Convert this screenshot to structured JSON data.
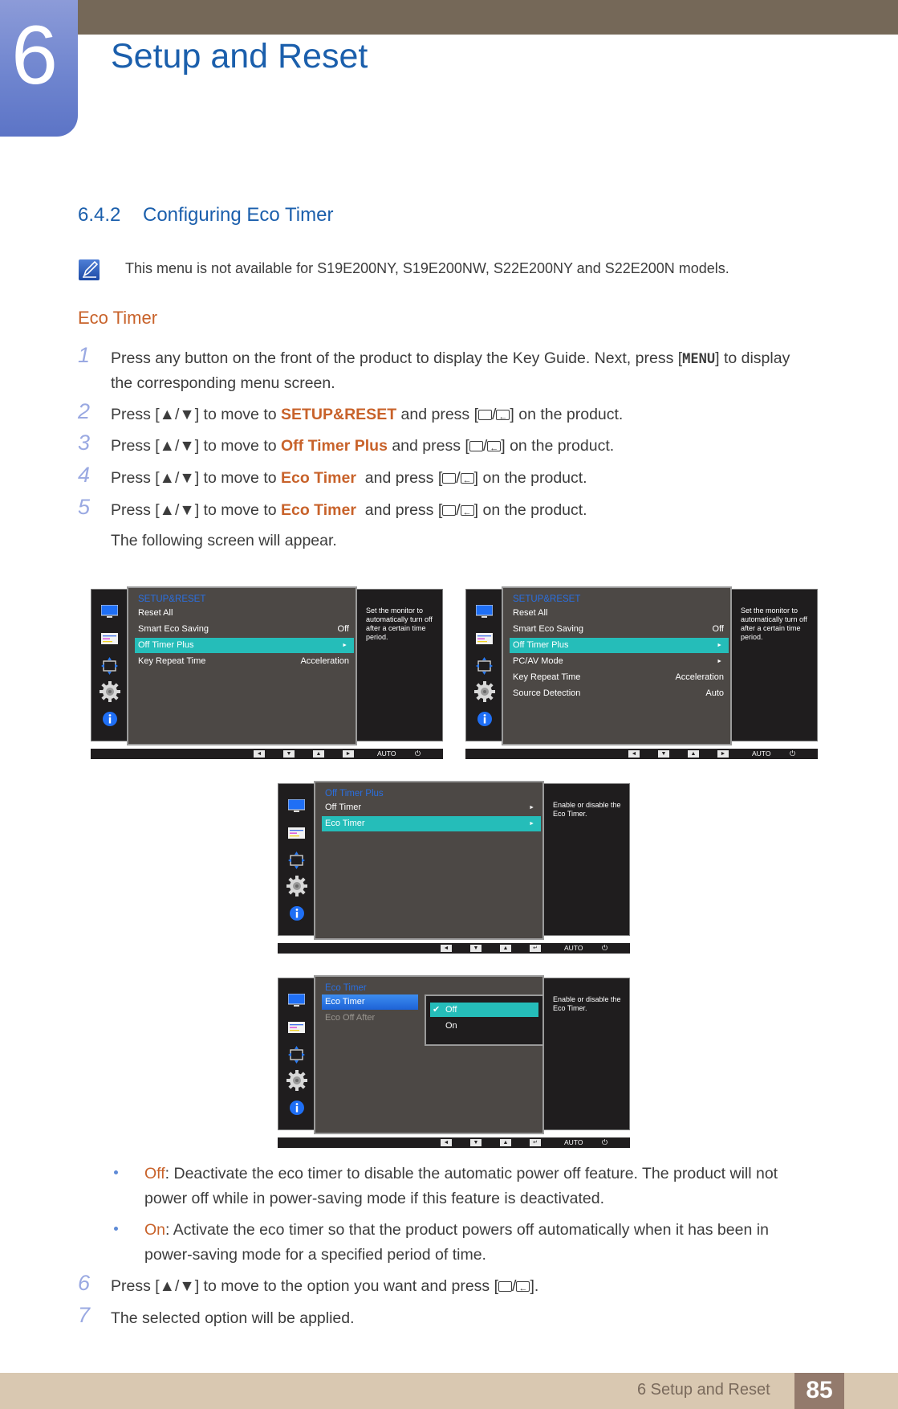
{
  "header": {
    "chapter_number": "6",
    "chapter_title": "Setup and Reset",
    "colors": {
      "bar": "#756858",
      "tab": "#6f85cf",
      "title": "#1b5fac"
    }
  },
  "section": {
    "number": "6.4.2",
    "title": "Configuring Eco Timer",
    "note_icon": "note-pencil-icon",
    "note": "This menu is not available for S19E200NY, S19E200NW, S22E200NY and S22E200N models.",
    "subheading": "Eco Timer"
  },
  "keys": {
    "menu": "MENU",
    "updown": "▲/▼",
    "enter_slash": "/"
  },
  "steps": [
    {
      "num": "1",
      "line1_a": "Press any button on the front of the product to display the Key Guide. Next, press [",
      "line1_b": "] to display",
      "line2": "the corresponding menu screen."
    },
    {
      "num": "2",
      "a": "Press [▲/▼] to move to ",
      "target": "SETUP&RESET",
      "b": " and press [",
      "c": "] on the product."
    },
    {
      "num": "3",
      "a": "Press [▲/▼] to move to ",
      "target": "Off Timer Plus",
      "b": " and press [",
      "c": "] on the product."
    },
    {
      "num": "4",
      "a": "Press [▲/▼] to move to ",
      "target": "Eco Timer",
      "b": "  and press [",
      "c": "] on the product."
    },
    {
      "num": "5",
      "a": "Press [▲/▼] to move to ",
      "target": "Eco Timer",
      "b": "  and press [",
      "c": "] on the product."
    },
    {
      "num": "6",
      "a": "Press [▲/▼] to move to the option you want and press [",
      "c": "]."
    },
    {
      "num": "7",
      "a": "The selected option will be applied."
    }
  ],
  "following_screen": "The following screen will appear.",
  "osd_common": {
    "keybar": {
      "left": "◄",
      "down": "▼",
      "up": "▲",
      "right": "►",
      "enter": "↵",
      "auto": "AUTO",
      "power": "⏻"
    },
    "side_icons": [
      "monitor-icon",
      "picture-icon",
      "size-position-icon",
      "gear-icon",
      "info-icon"
    ]
  },
  "osd_panels": [
    {
      "title": "SETUP&RESET",
      "help": "Set the monitor to automatically turn off after a certain time period.",
      "rows": [
        {
          "label": "Reset All",
          "value": ""
        },
        {
          "label": "Smart Eco Saving",
          "value": "Off"
        },
        {
          "label": "Off Timer Plus",
          "value": "►",
          "selected": true
        },
        {
          "label": "Key Repeat Time",
          "value": "Acceleration"
        }
      ]
    },
    {
      "title": "SETUP&RESET",
      "help": "Set the monitor to automatically turn off after a certain time period.",
      "rows": [
        {
          "label": "Reset All",
          "value": ""
        },
        {
          "label": "Smart Eco Saving",
          "value": "Off"
        },
        {
          "label": "Off Timer Plus",
          "value": "►",
          "selected": true
        },
        {
          "label": "PC/AV Mode",
          "value": "►"
        },
        {
          "label": "Key Repeat Time",
          "value": "Acceleration"
        },
        {
          "label": "Source Detection",
          "value": "Auto"
        }
      ]
    },
    {
      "title": "Off Timer Plus",
      "help": "Enable or disable the Eco Timer.",
      "rows": [
        {
          "label": "Off Timer",
          "value": "►"
        },
        {
          "label": "Eco Timer",
          "value": "►",
          "selected": true
        }
      ]
    },
    {
      "title": "Eco Timer",
      "help": "Enable or disable the Eco Timer.",
      "rows": [
        {
          "label": "Eco Timer",
          "value": "",
          "selected": true
        },
        {
          "label": "Eco Off After",
          "value": "",
          "disabled": true
        }
      ],
      "popup": {
        "options": [
          {
            "label": "Off",
            "checked": true,
            "selected": true
          },
          {
            "label": "On",
            "checked": false,
            "selected": false
          }
        ]
      }
    }
  ],
  "bullets": [
    {
      "term": "Off",
      "text": ": Deactivate the eco timer to disable the automatic power off feature. The product will not",
      "text2": "power off while in power-saving mode if this feature is deactivated."
    },
    {
      "term": "On",
      "text": ": Activate the eco timer so that the product powers off automatically when it has been in",
      "text2": "power-saving mode for a specified period of time."
    }
  ],
  "footer": {
    "section": "6 Setup and Reset",
    "page": "85"
  }
}
